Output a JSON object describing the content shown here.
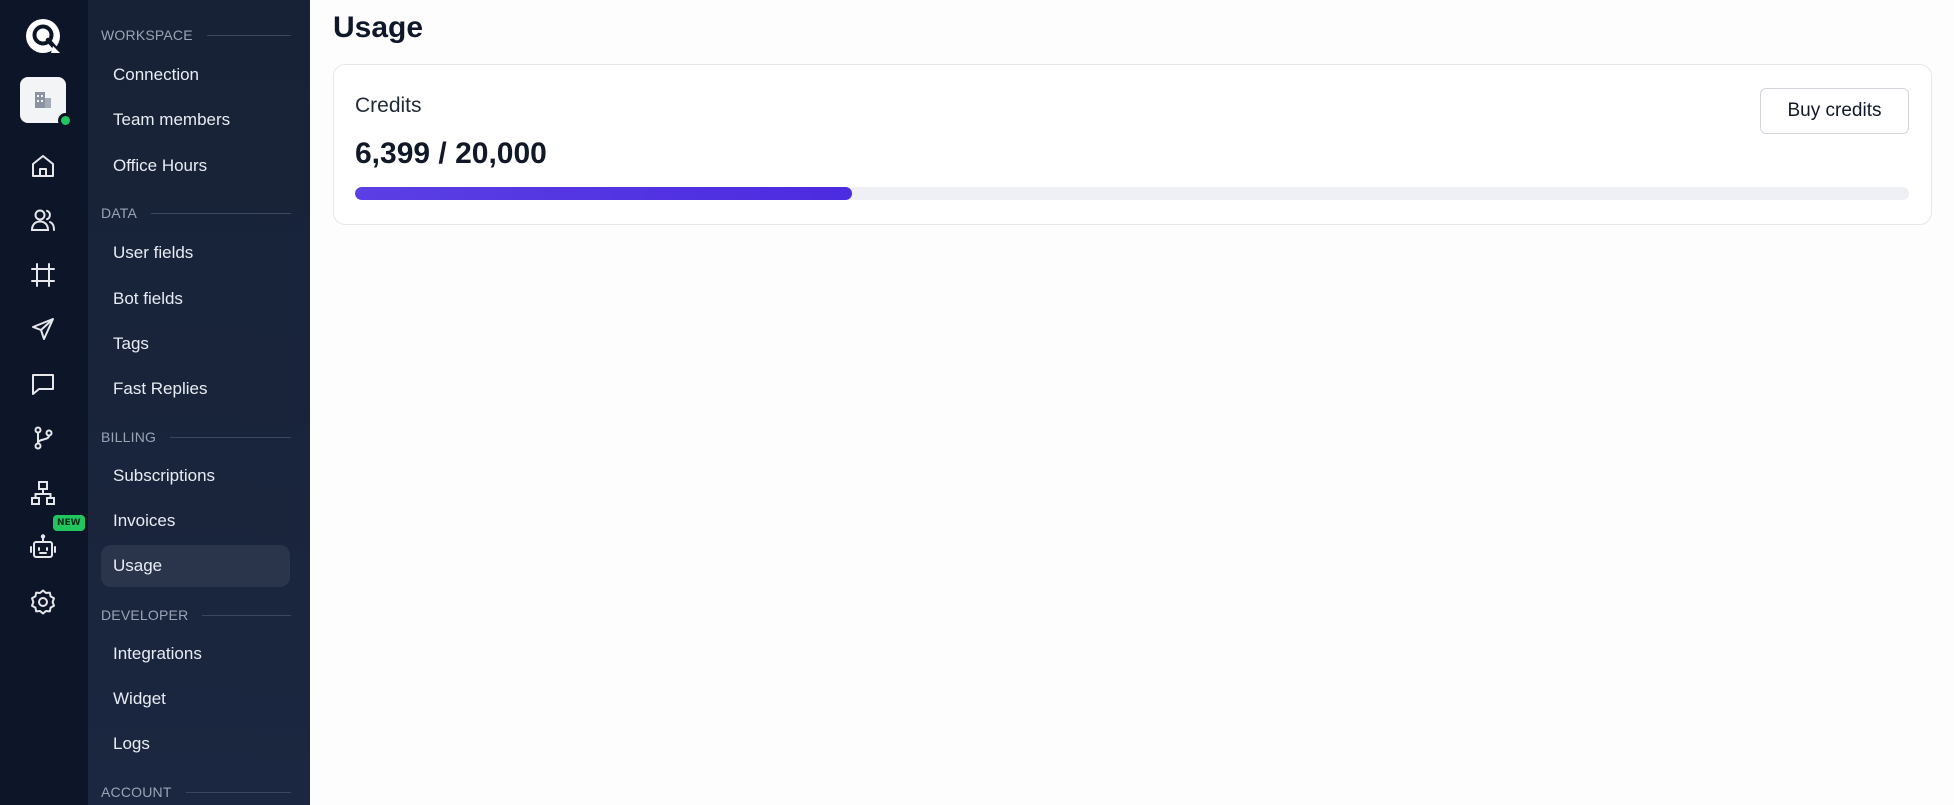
{
  "rail": {
    "items": [
      {
        "name": "home-icon"
      },
      {
        "name": "users-icon"
      },
      {
        "name": "frame-icon"
      },
      {
        "name": "send-icon"
      },
      {
        "name": "chat-icon"
      },
      {
        "name": "branch-icon"
      },
      {
        "name": "sitemap-icon"
      },
      {
        "name": "robot-icon",
        "badge": "NEW"
      },
      {
        "name": "settings-icon"
      }
    ]
  },
  "sidebar": {
    "sections": [
      {
        "title": "WORKSPACE",
        "items": [
          "Connection",
          "Team members",
          "Office Hours"
        ]
      },
      {
        "title": "DATA",
        "items": [
          "User fields",
          "Bot fields",
          "Tags",
          "Fast Replies"
        ]
      },
      {
        "title": "BILLING",
        "items": [
          "Subscriptions",
          "Invoices",
          "Usage"
        ]
      },
      {
        "title": "DEVELOPER",
        "items": [
          "Integrations",
          "Widget",
          "Logs"
        ]
      },
      {
        "title": "ACCOUNT",
        "items": []
      }
    ],
    "active_item": "Usage"
  },
  "main": {
    "title": "Usage",
    "credits": {
      "label": "Credits",
      "amount_text": "6,399 / 20,000",
      "used": 6399,
      "total": 20000,
      "buy_label": "Buy credits"
    }
  },
  "colors": {
    "accent": "#4c2be0",
    "rail_bg": "#0d1628",
    "sidebar_bg": "#172236",
    "status_online": "#22c55e"
  }
}
